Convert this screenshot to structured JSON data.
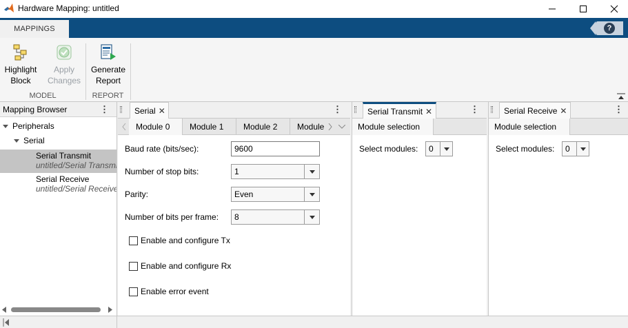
{
  "window": {
    "title": "Hardware Mapping: untitled",
    "accent": "#0d4d80"
  },
  "ribbon": {
    "tab": "MAPPINGS",
    "help_label": "?",
    "buttons": [
      {
        "line1": "Highlight",
        "line2": "Block",
        "icon": "highlight-block-icon",
        "enabled": true
      },
      {
        "line1": "Apply",
        "line2": "Changes",
        "icon": "apply-changes-icon",
        "enabled": false
      },
      {
        "line1": "Generate",
        "line2": "Report",
        "icon": "generate-report-icon",
        "enabled": true
      }
    ],
    "sections": [
      "MODEL",
      "REPORT"
    ]
  },
  "browser": {
    "title": "Mapping Browser",
    "tree": {
      "root": "Peripherals",
      "group": "Serial",
      "items": [
        {
          "label": "Serial Transmit",
          "sub": "untitled/Serial Transmit"
        },
        {
          "label": "Serial Receive",
          "sub": "untitled/Serial Receive"
        }
      ]
    }
  },
  "serial_panel": {
    "tab": "Serial",
    "module_tabs": [
      "Module 0",
      "Module 1",
      "Module 2",
      "Module"
    ],
    "fields": {
      "baud_label": "Baud rate (bits/sec):",
      "baud_value": "9600",
      "stop_label": "Number of stop bits:",
      "stop_value": "1",
      "parity_label": "Parity:",
      "parity_value": "Even",
      "bits_label": "Number of bits per frame:",
      "bits_value": "8"
    },
    "checks": [
      "Enable and configure Tx",
      "Enable and configure Rx",
      "Enable error event"
    ]
  },
  "transmit_panel": {
    "tab": "Serial Transmit",
    "section": "Module selection",
    "select_label": "Select modules:",
    "select_value": "0"
  },
  "receive_panel": {
    "tab": "Serial Receive",
    "section": "Module selection",
    "select_label": "Select modules:",
    "select_value": "0"
  }
}
